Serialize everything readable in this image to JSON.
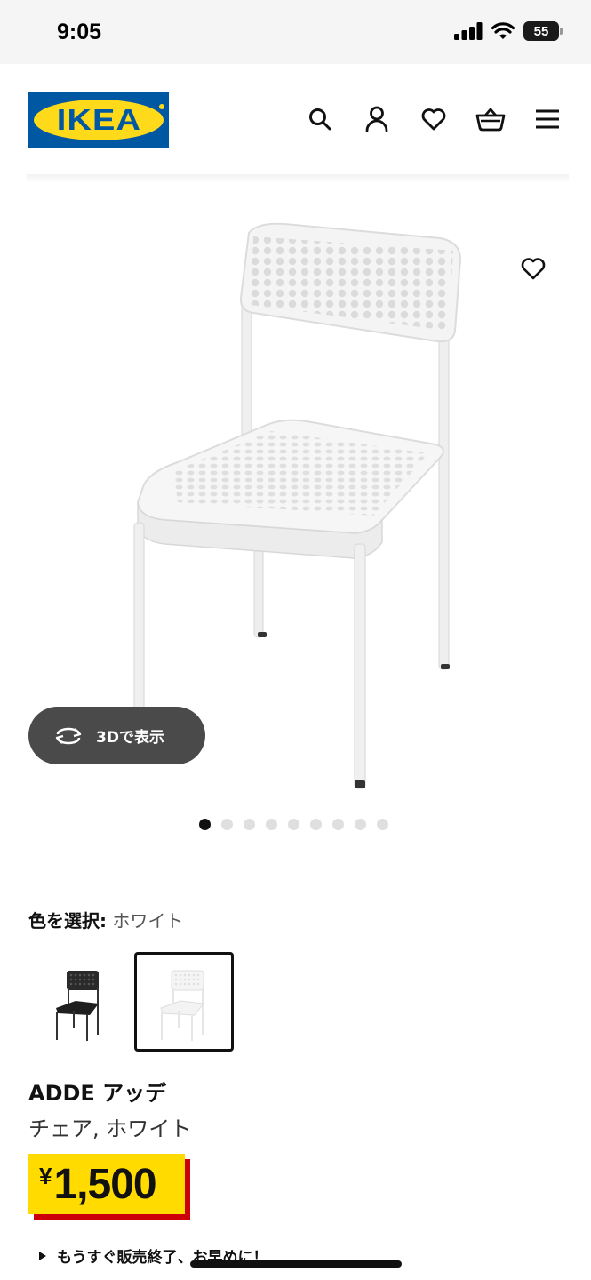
{
  "status_bar": {
    "time": "9:05",
    "battery": "55"
  },
  "header": {
    "logo_text": "IKEA",
    "icons": [
      "search-icon",
      "account-icon",
      "wishlist-icon",
      "cart-icon",
      "menu-icon"
    ]
  },
  "gallery": {
    "image_alt": "ADDE chair white",
    "view3d_label": "3Dで表示",
    "total_images": 9,
    "active_index": 0
  },
  "color": {
    "label": "色を選択:",
    "value": "ホワイト",
    "options": [
      {
        "name": "ブラック",
        "selected": false
      },
      {
        "name": "ホワイト",
        "selected": true
      }
    ]
  },
  "product": {
    "name": "ADDE アッデ",
    "description": "チェア, ホワイト",
    "currency": "¥",
    "price": "1,500"
  },
  "notice": "もうすぐ販売終了、お早めに！",
  "colors": {
    "ikea_blue": "#0058a3",
    "ikea_yellow": "#ffda1a",
    "price_red": "#cc0008"
  }
}
